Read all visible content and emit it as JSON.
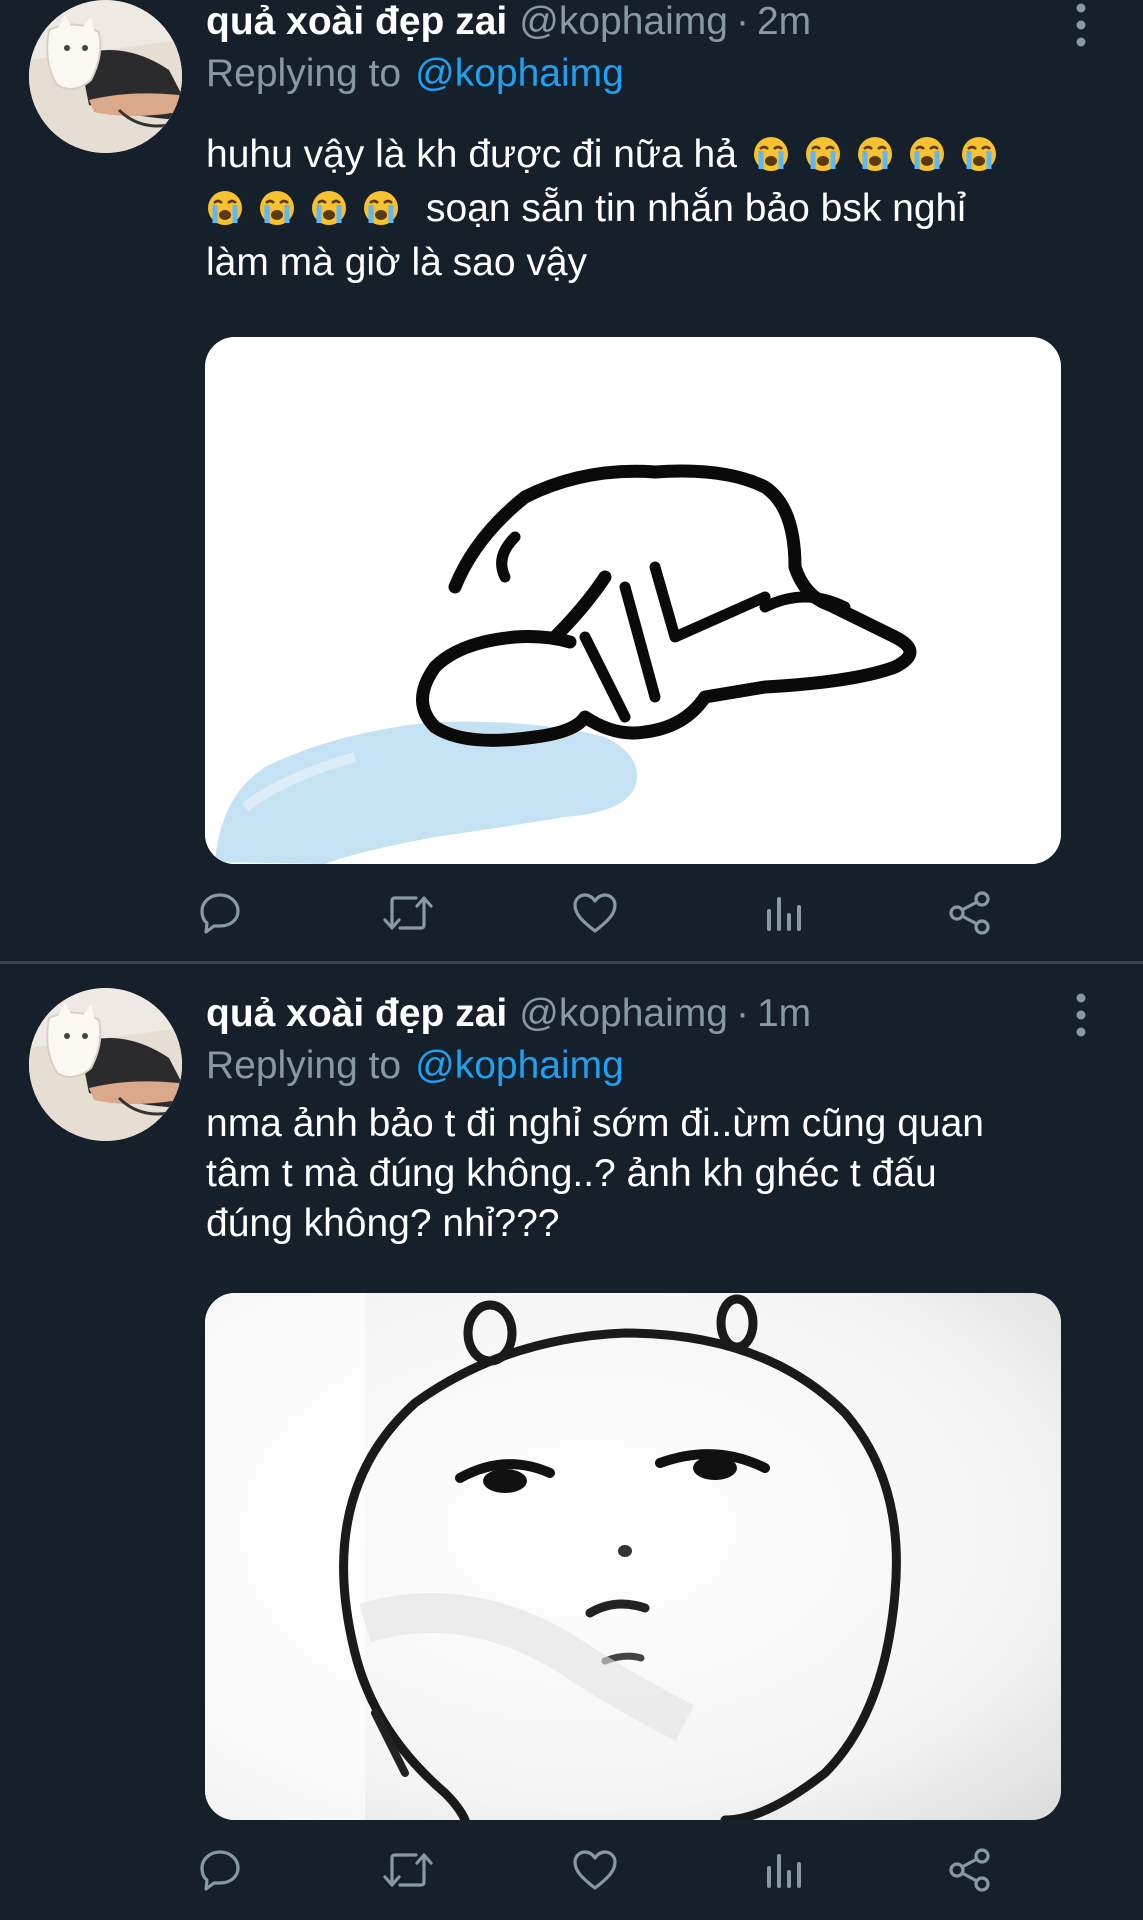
{
  "tweets": [
    {
      "display_name": "quả xoài đẹp zai",
      "handle": "@kophaimg",
      "separator": "·",
      "time": "2m",
      "reply_prefix": "Replying to",
      "reply_target": "@kophaimg",
      "text_line1": "huhu vậy là kh được đi nữa hả",
      "text_line2": "soạn sẵn tin nhắn bảo bsk nghỉ",
      "text_line3": "làm mà giờ là sao vậy",
      "emojis_line1": [
        "loudly-crying-face-icon",
        "loudly-crying-face-icon",
        "loudly-crying-face-icon",
        "loudly-crying-face-icon",
        "loudly-crying-face-icon"
      ],
      "emojis_line2": [
        "loudly-crying-face-icon",
        "loudly-crying-face-icon",
        "loudly-crying-face-icon",
        "loudly-crying-face-icon"
      ],
      "media": "sketch-figure-kneeling-crying"
    },
    {
      "display_name": "quả xoài đẹp zai",
      "handle": "@kophaimg",
      "separator": "·",
      "time": "1m",
      "reply_prefix": "Replying to",
      "reply_target": "@kophaimg",
      "text_line1": "nma ảnh bảo t đi nghỉ sớm đi..ừm cũng quan",
      "text_line2": "tâm t mà đúng không..? ảnh kh ghéc t đấu",
      "text_line3": "đúng không? nhỉ???",
      "media": "sketch-round-face-blank-stare"
    }
  ],
  "action_icons": [
    "reply-icon",
    "retweet-icon",
    "like-icon",
    "analytics-icon",
    "share-icon"
  ],
  "colors": {
    "background": "#15202b",
    "divider": "#38444d",
    "secondary_text": "#8899a6",
    "accent": "#1da1f2",
    "primary_text": "#ffffff"
  }
}
